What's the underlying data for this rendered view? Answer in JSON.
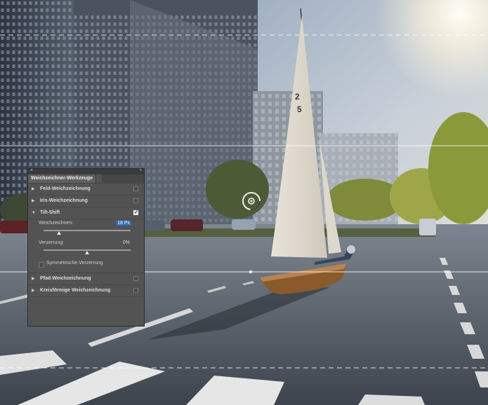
{
  "panel": {
    "close_glyph": "×",
    "collapse_glyph": "»",
    "title": "Weichzeichner-Werkzeuge",
    "sections": [
      {
        "label": "Feld-Weichzeichnung",
        "checked": false,
        "expanded": false
      },
      {
        "label": "Iris-Weichzeichnung",
        "checked": false,
        "expanded": false
      },
      {
        "label": "Tilt-Shift",
        "checked": true,
        "expanded": true
      },
      {
        "label": "Pfad-Weichzeichnung",
        "checked": false,
        "expanded": false
      },
      {
        "label": "Kreisförmige Weichzeichnung",
        "checked": false,
        "expanded": false
      }
    ],
    "tilt_shift": {
      "blur_label": "Weichzeichnen:",
      "blur_value": "18 Px",
      "blur_level": 0.18,
      "distortion_label": "Verzerrung:",
      "distortion_value": "0%",
      "distortion_level": 0.5,
      "symmetric_label": "Symmetrische Verzerrung",
      "symmetric_checked": false
    }
  },
  "sail_number": "2\n5",
  "colors": {
    "accent": "#2f6dc2",
    "panel_bg": "#535353"
  },
  "icons": {
    "collapsed": "▶",
    "expanded": "▼"
  }
}
